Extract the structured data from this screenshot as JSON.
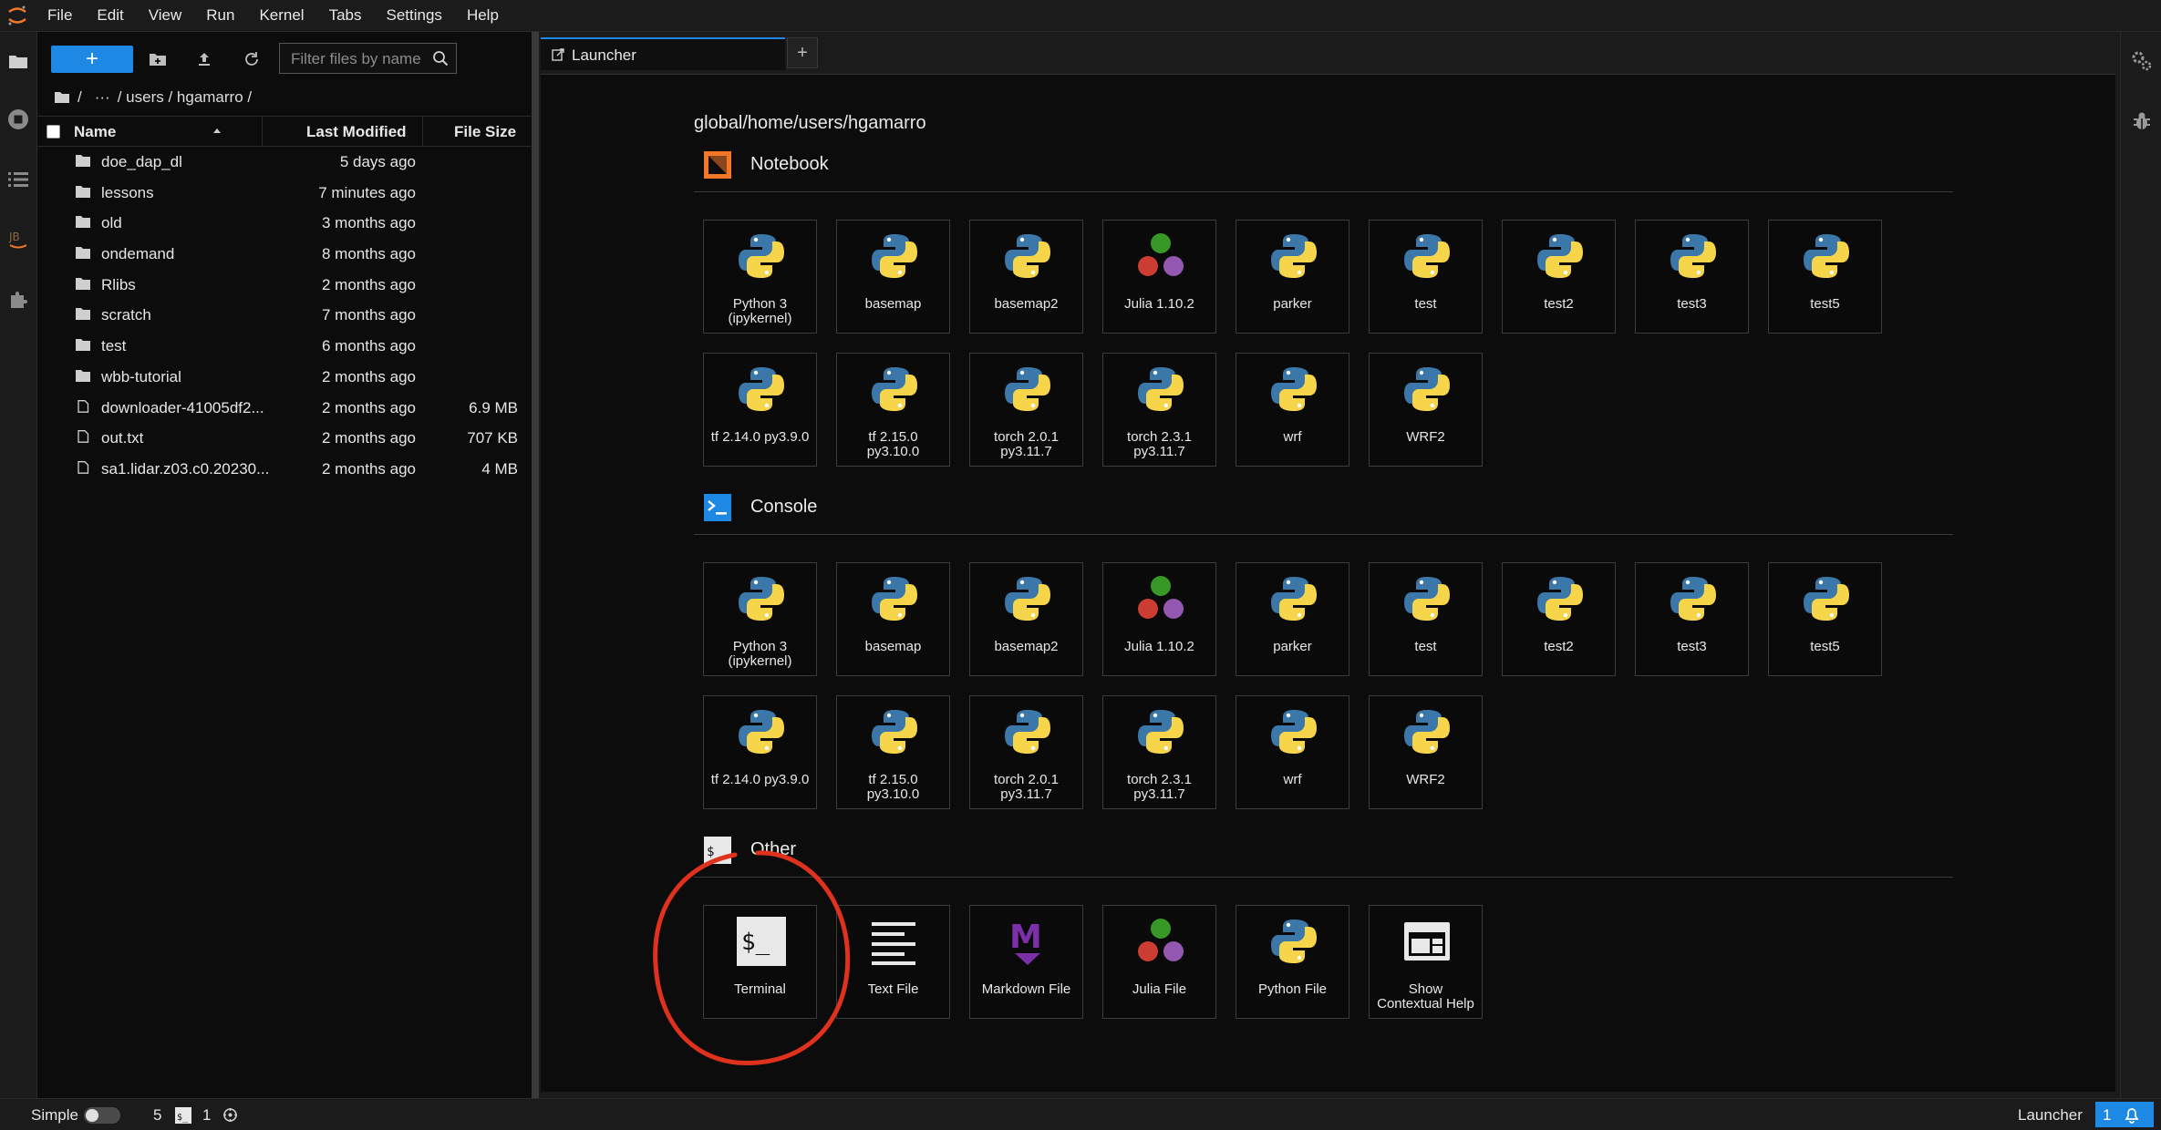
{
  "menubar": {
    "items": [
      "File",
      "Edit",
      "View",
      "Run",
      "Kernel",
      "Tabs",
      "Settings",
      "Help"
    ]
  },
  "browser": {
    "new_label": "+",
    "filter_placeholder": "Filter files by name",
    "breadcrumb": {
      "sep1": "/",
      "ellipsis": "···",
      "path": "/ users / hgamarro /"
    },
    "columns": {
      "name": "Name",
      "modified": "Last Modified",
      "size": "File Size"
    },
    "files": [
      {
        "name": "doe_dap_dl",
        "modified": "5 days ago",
        "size": "",
        "type": "folder"
      },
      {
        "name": "lessons",
        "modified": "7 minutes ago",
        "size": "",
        "type": "folder"
      },
      {
        "name": "old",
        "modified": "3 months ago",
        "size": "",
        "type": "folder"
      },
      {
        "name": "ondemand",
        "modified": "8 months ago",
        "size": "",
        "type": "folder"
      },
      {
        "name": "Rlibs",
        "modified": "2 months ago",
        "size": "",
        "type": "folder"
      },
      {
        "name": "scratch",
        "modified": "7 months ago",
        "size": "",
        "type": "folder"
      },
      {
        "name": "test",
        "modified": "6 months ago",
        "size": "",
        "type": "folder"
      },
      {
        "name": "wbb-tutorial",
        "modified": "2 months ago",
        "size": "",
        "type": "folder"
      },
      {
        "name": "downloader-41005df2...",
        "modified": "2 months ago",
        "size": "6.9 MB",
        "type": "file"
      },
      {
        "name": "out.txt",
        "modified": "2 months ago",
        "size": "707 KB",
        "type": "file"
      },
      {
        "name": "sa1.lidar.z03.c0.20230...",
        "modified": "2 months ago",
        "size": "4 MB",
        "type": "file"
      }
    ]
  },
  "tabs": {
    "launcher_label": "Launcher",
    "add_label": "+"
  },
  "launcher": {
    "cwd": "global/home/users/hgamarro",
    "notebook": {
      "title": "Notebook",
      "kernels": [
        {
          "label": "Python 3\n(ipykernel)",
          "icon": "python-icon"
        },
        {
          "label": "basemap",
          "icon": "python-icon"
        },
        {
          "label": "basemap2",
          "icon": "python-icon"
        },
        {
          "label": "Julia 1.10.2",
          "icon": "julia-icon"
        },
        {
          "label": "parker",
          "icon": "python-icon"
        },
        {
          "label": "test",
          "icon": "python-icon"
        },
        {
          "label": "test2",
          "icon": "python-icon"
        },
        {
          "label": "test3",
          "icon": "python-icon"
        },
        {
          "label": "test5",
          "icon": "python-icon"
        },
        {
          "label": "tf 2.14.0 py3.9.0",
          "icon": "python-icon"
        },
        {
          "label": "tf 2.15.0\npy3.10.0",
          "icon": "python-icon"
        },
        {
          "label": "torch 2.0.1\npy3.11.7",
          "icon": "python-icon"
        },
        {
          "label": "torch 2.3.1\npy3.11.7",
          "icon": "python-icon"
        },
        {
          "label": "wrf",
          "icon": "python-icon"
        },
        {
          "label": "WRF2",
          "icon": "python-icon"
        }
      ]
    },
    "console": {
      "title": "Console",
      "kernels": [
        {
          "label": "Python 3\n(ipykernel)",
          "icon": "python-icon"
        },
        {
          "label": "basemap",
          "icon": "python-icon"
        },
        {
          "label": "basemap2",
          "icon": "python-icon"
        },
        {
          "label": "Julia 1.10.2",
          "icon": "julia-icon"
        },
        {
          "label": "parker",
          "icon": "python-icon"
        },
        {
          "label": "test",
          "icon": "python-icon"
        },
        {
          "label": "test2",
          "icon": "python-icon"
        },
        {
          "label": "test3",
          "icon": "python-icon"
        },
        {
          "label": "test5",
          "icon": "python-icon"
        },
        {
          "label": "tf 2.14.0 py3.9.0",
          "icon": "python-icon"
        },
        {
          "label": "tf 2.15.0\npy3.10.0",
          "icon": "python-icon"
        },
        {
          "label": "torch 2.0.1\npy3.11.7",
          "icon": "python-icon"
        },
        {
          "label": "torch 2.3.1\npy3.11.7",
          "icon": "python-icon"
        },
        {
          "label": "wrf",
          "icon": "python-icon"
        },
        {
          "label": "WRF2",
          "icon": "python-icon"
        }
      ]
    },
    "other": {
      "title": "Other",
      "items": [
        {
          "label": "Terminal",
          "icon": "terminal-icon"
        },
        {
          "label": "Text File",
          "icon": "text-file-icon"
        },
        {
          "label": "Markdown File",
          "icon": "markdown-icon"
        },
        {
          "label": "Julia File",
          "icon": "julia-icon"
        },
        {
          "label": "Python File",
          "icon": "python-icon"
        },
        {
          "label": "Show\nContextual Help",
          "icon": "contextual-help-icon"
        }
      ]
    }
  },
  "statusbar": {
    "mode_label": "Simple",
    "kernel_count": "5",
    "terminal_count": "1",
    "right_label": "Launcher",
    "notification_count": "1"
  },
  "colors": {
    "accent": "#1e88e5",
    "notebook_icon": "#f37726",
    "annotation": "#e0311d",
    "python_blue": "#3b77a8",
    "python_yellow": "#f7d54a"
  }
}
